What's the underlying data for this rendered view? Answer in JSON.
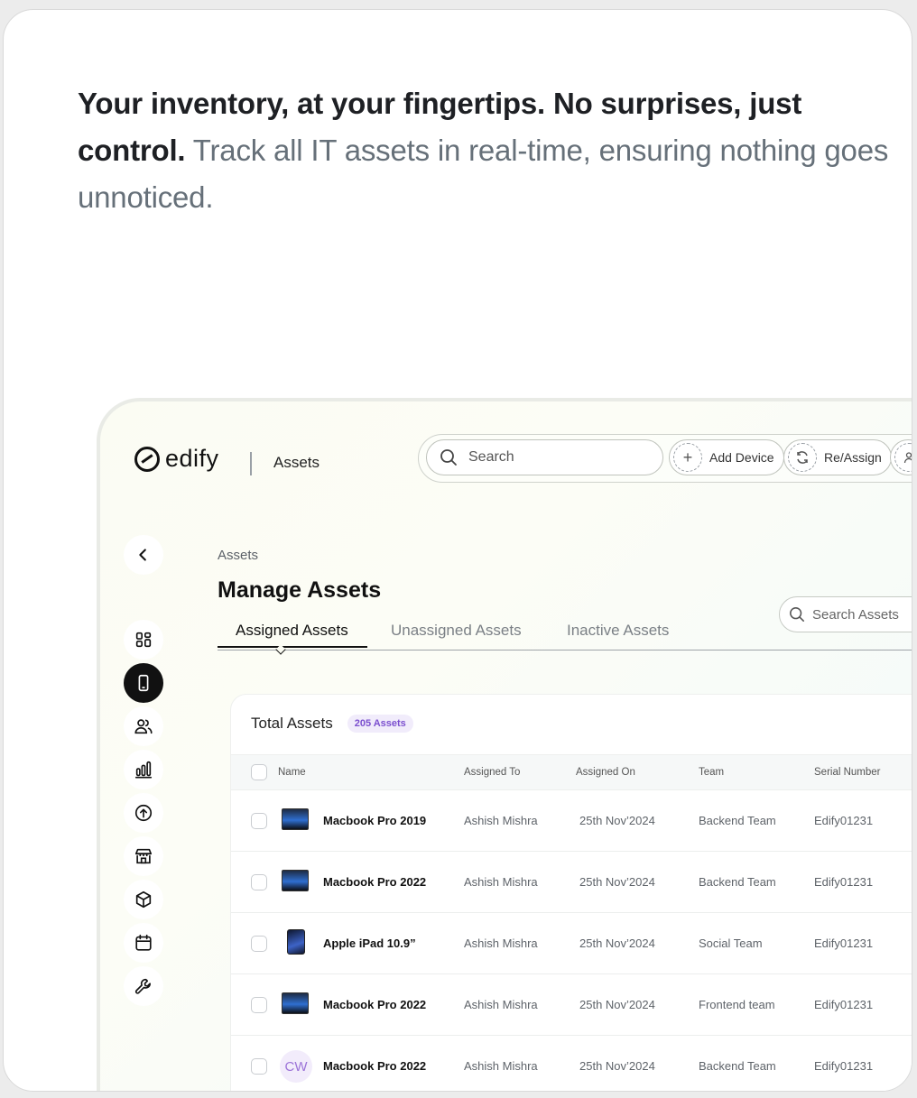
{
  "headline": {
    "strong": "Your inventory, at your fingertips. No surprises, just control.",
    "muted": " Track all IT assets in real-time, ensuring nothing goes unnoticed."
  },
  "app": {
    "logo_text": "edify",
    "section": "Assets",
    "search_placeholder": "Search",
    "add_device_label": "Add Device",
    "reassign_label": "Re/Assign"
  },
  "sidebar": {
    "icons": [
      "chevron-left-icon",
      "dashboard-icon",
      "device-icon",
      "users-icon",
      "bar-chart-icon",
      "upload-icon",
      "store-icon",
      "box-icon",
      "calendar-icon",
      "wrench-icon"
    ],
    "active_index": 2
  },
  "main": {
    "breadcrumb": "Assets",
    "title": "Manage Assets",
    "tabs": [
      "Assigned Assets",
      "Unassigned Assets",
      "Inactive Assets"
    ],
    "active_tab": 0,
    "search_assets_placeholder": "Search Assets"
  },
  "table": {
    "total_label": "Total Assets",
    "count_badge": "205 Assets",
    "columns": [
      "Name",
      "Assigned To",
      "Assigned On",
      "Team",
      "Serial Number"
    ],
    "rows": [
      {
        "thumb": "laptop",
        "name": "Macbook Pro 2019",
        "assigned_to": "Ashish Mishra",
        "assigned_on": "25th Nov’2024",
        "team": "Backend Team",
        "serial": "Edify01231"
      },
      {
        "thumb": "laptop",
        "name": "Macbook Pro 2022",
        "assigned_to": "Ashish Mishra",
        "assigned_on": "25th Nov’2024",
        "team": "Backend Team",
        "serial": "Edify01231"
      },
      {
        "thumb": "tablet",
        "name": "Apple iPad 10.9”",
        "assigned_to": "Ashish Mishra",
        "assigned_on": "25th Nov’2024",
        "team": "Social Team",
        "serial": "Edify01231"
      },
      {
        "thumb": "laptop",
        "name": "Macbook Pro 2022",
        "assigned_to": "Ashish Mishra",
        "assigned_on": "25th Nov’2024",
        "team": "Frontend team",
        "serial": "Edify01231"
      },
      {
        "thumb": "CW",
        "name": "Macbook Pro 2022",
        "assigned_to": "Ashish Mishra",
        "assigned_on": "25th Nov’2024",
        "team": "Backend Team",
        "serial": "Edify01231"
      }
    ]
  },
  "colors": {
    "accent_purple": "#7b4fcf",
    "active_black": "#111111"
  }
}
